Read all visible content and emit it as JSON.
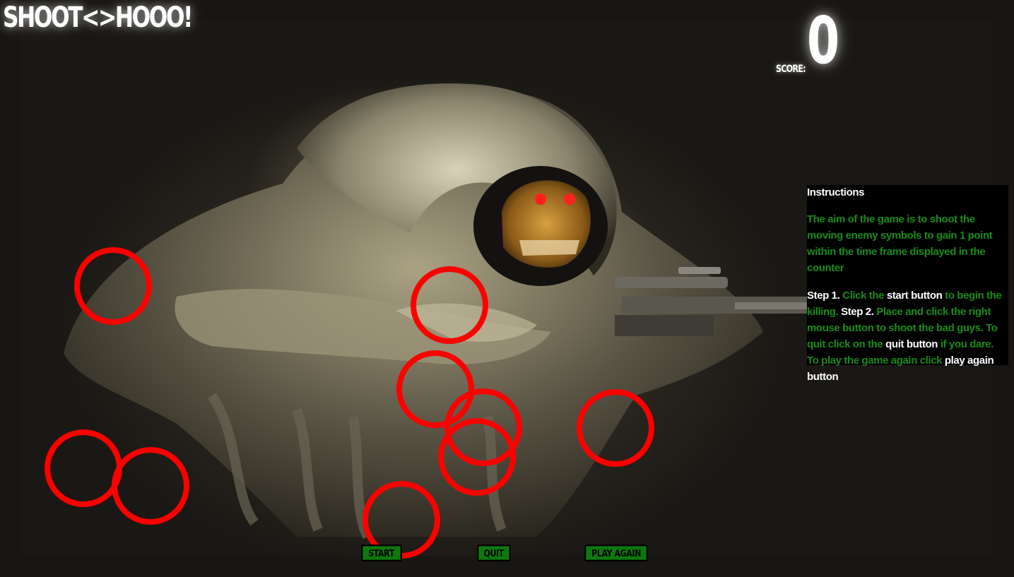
{
  "game": {
    "title": "SHOOT<>HOOO!",
    "score_label": "SCORE:",
    "score_value": "0"
  },
  "instructions": {
    "heading": "Instructions",
    "aim": "The aim of the game is to shoot the moving enemy symbols to gain 1 point within the time frame displayed in the counter",
    "step1_label": "Step 1.",
    "step1_text_a": "Click the",
    "step1_bold": "start button",
    "step1_text_b": "to begin the killing.",
    "step2_label": "Step 2.",
    "step2_text_a": "Place and click the right mouse button to shoot the bad guys. To quit click on the",
    "quit_bold": "quit button",
    "step2_text_b": "if you dare. To play the game again click",
    "play_again_bold": "play again button"
  },
  "controls": {
    "start_label": "START",
    "quit_label": "QUIT",
    "play_again_label": "PLAY AGAIN"
  },
  "targets": {
    "count": 10,
    "color": "#ff0000"
  },
  "colors": {
    "instruction_text": "#1a8a1a",
    "instruction_highlight": "#ffffff",
    "button_bg": "#0b7a0b",
    "target_ring": "#ff0000"
  }
}
